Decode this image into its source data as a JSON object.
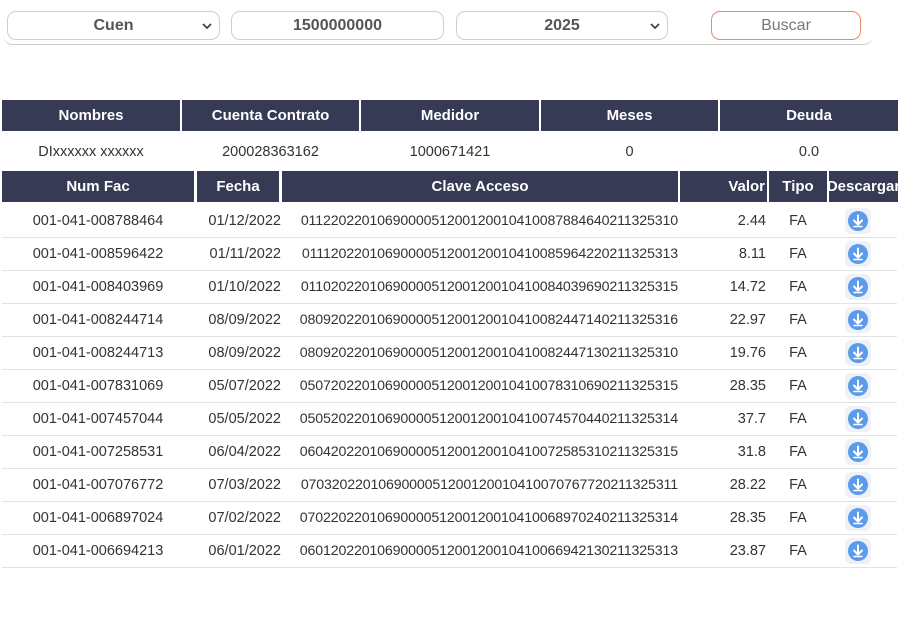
{
  "search": {
    "tipo_selected": "Cuen",
    "numero_value": "1500000000",
    "year_selected": "2025",
    "buscar_label": "Buscar"
  },
  "summary": {
    "headers": [
      "Nombres",
      "Cuenta Contrato",
      "Medidor",
      "Meses",
      "Deuda"
    ],
    "values": [
      "DIxxxxxx xxxxxx",
      "200028363162",
      "1000671421",
      "0",
      "0.0"
    ]
  },
  "invoices": {
    "headers": [
      "Num Fac",
      "Fecha",
      "Clave Acceso",
      "Valor",
      "Tipo",
      "Descargar"
    ],
    "rows": [
      [
        "001-041-008788464",
        "01/12/2022",
        "0112202201069000051200120010410087884640211325310",
        "2.44",
        "FA"
      ],
      [
        "001-041-008596422",
        "01/11/2022",
        "0111202201069000051200120010410085964220211325313",
        "8.11",
        "FA"
      ],
      [
        "001-041-008403969",
        "01/10/2022",
        "0110202201069000051200120010410084039690211325315",
        "14.72",
        "FA"
      ],
      [
        "001-041-008244714",
        "08/09/2022",
        "0809202201069000051200120010410082447140211325316",
        "22.97",
        "FA"
      ],
      [
        "001-041-008244713",
        "08/09/2022",
        "0809202201069000051200120010410082447130211325310",
        "19.76",
        "FA"
      ],
      [
        "001-041-007831069",
        "05/07/2022",
        "0507202201069000051200120010410078310690211325315",
        "28.35",
        "FA"
      ],
      [
        "001-041-007457044",
        "05/05/2022",
        "0505202201069000051200120010410074570440211325314",
        "37.7",
        "FA"
      ],
      [
        "001-041-007258531",
        "06/04/2022",
        "0604202201069000051200120010410072585310211325315",
        "31.8",
        "FA"
      ],
      [
        "001-041-007076772",
        "07/03/2022",
        "0703202201069000051200120010410070767720211325311",
        "28.22",
        "FA"
      ],
      [
        "001-041-006897024",
        "07/02/2022",
        "0702202201069000051200120010410068970240211325314",
        "28.35",
        "FA"
      ],
      [
        "001-041-006694213",
        "06/01/2022",
        "0601202201069000051200120010410066942130211325313",
        "23.87",
        "FA"
      ]
    ],
    "download_icon": "download-circle-icon"
  },
  "colors": {
    "header_bg": "#363a54",
    "download_icon": "#5b9bea",
    "button_border": "#e88b6a"
  }
}
